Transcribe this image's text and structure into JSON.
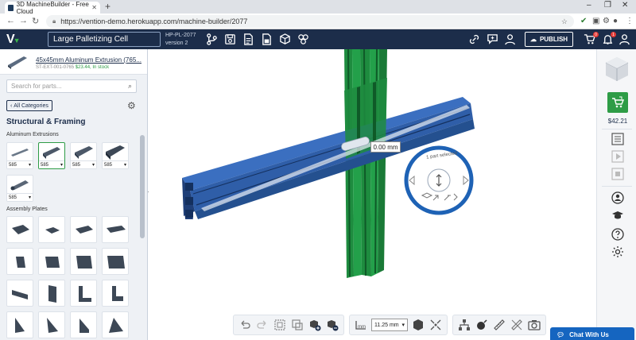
{
  "browser": {
    "tab_title": "3D MachineBuilder - Free Cloud",
    "new_tab": "+",
    "url": "https://vention-demo.herokuapp.com/machine-builder/2077",
    "min": "–",
    "max": "❐",
    "close": "✕"
  },
  "header": {
    "project_name": "Large Palletizing Cell",
    "project_id": "HP-PL-2077",
    "version": "version 2",
    "publish_label": "PUBLISH",
    "cart_badge": "0",
    "notif_badge": "1"
  },
  "sidebar": {
    "selected_part": {
      "name": "45x45mm Aluminum Extrusion (765...",
      "sku": "ST-EXT-001-0765",
      "price": "$23.44, In stock"
    },
    "search_placeholder": "Search for parts...",
    "all_categories": "All Categories",
    "section_title": "Structural & Framing",
    "group_extrusions": "Aluminum Extrusions",
    "group_plates": "Assembly Plates",
    "extrusions": [
      {
        "length": "585"
      },
      {
        "length": "585"
      },
      {
        "length": "585"
      },
      {
        "length": "585"
      },
      {
        "length": "585"
      }
    ]
  },
  "viewport": {
    "measure": "0.00 mm",
    "selection_label": "1 part selected"
  },
  "toolbar": {
    "grid_size": "11.25 mm",
    "unit_label": "mm"
  },
  "right_panel": {
    "cart_total": "$42.21"
  },
  "chat": {
    "label": "Chat With Us"
  },
  "colors": {
    "header_bg": "#1c2d4a",
    "accent_green": "#2e9c46",
    "extrusion_blue": "#2f5ea8",
    "extrusion_green": "#23a04a",
    "chat_blue": "#1565c0"
  }
}
